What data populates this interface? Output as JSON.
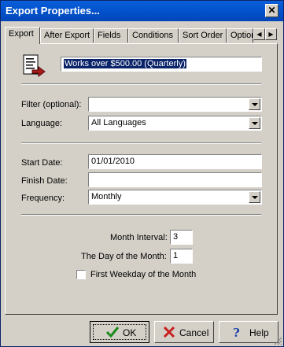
{
  "window": {
    "title": "Export Properties..."
  },
  "tabs": [
    {
      "label": "Export",
      "active": true
    },
    {
      "label": "After Export"
    },
    {
      "label": "Fields"
    },
    {
      "label": "Conditions"
    },
    {
      "label": "Sort Order"
    },
    {
      "label": "Option"
    }
  ],
  "export": {
    "name": "Works over $500.00 (Quarterly)",
    "filter_label": "Filter (optional):",
    "filter_value": "",
    "language_label": "Language:",
    "language_value": "All Languages",
    "start_label": "Start Date:",
    "start_value": "01/01/2010",
    "finish_label": "Finish Date:",
    "finish_value": "",
    "frequency_label": "Frequency:",
    "frequency_value": "Monthly",
    "interval_label": "Month Interval:",
    "interval_value": "3",
    "day_label": "The Day of the Month:",
    "day_value": "1",
    "first_weekday_label": "First Weekday of the Month",
    "first_weekday_checked": false
  },
  "buttons": {
    "ok": "OK",
    "cancel": "Cancel",
    "help": "Help"
  },
  "colors": {
    "titlebar": "#0a5fd8",
    "selection": "#0a246a",
    "face": "#d4d0c8"
  }
}
